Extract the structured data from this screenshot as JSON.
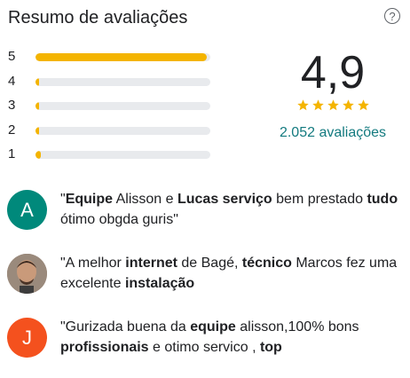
{
  "header": {
    "title": "Resumo de avaliações",
    "help_icon": "?"
  },
  "rating_bars": [
    {
      "label": "5",
      "fraction": 0.98
    },
    {
      "label": "4",
      "fraction": 0.02
    },
    {
      "label": "3",
      "fraction": 0.02
    },
    {
      "label": "2",
      "fraction": 0.02
    },
    {
      "label": "1",
      "fraction": 0.03
    }
  ],
  "summary": {
    "score": "4,9",
    "stars": 5,
    "reviews_count": "2.052 avaliações"
  },
  "colors": {
    "star": "#f4b400",
    "bar_track": "#e8eaed",
    "link": "#137a7f"
  },
  "reviews": [
    {
      "avatar_letter": "A",
      "avatar_type": "letter",
      "parts": [
        {
          "t": "\"",
          "b": false
        },
        {
          "t": "Equipe",
          "b": true
        },
        {
          "t": " Alisson e ",
          "b": false
        },
        {
          "t": "Lucas serviço",
          "b": true
        },
        {
          "t": " bem prestado ",
          "b": false
        },
        {
          "t": "tudo",
          "b": true
        },
        {
          "t": " ótimo obgda guris\"",
          "b": false
        }
      ]
    },
    {
      "avatar_letter": "",
      "avatar_type": "photo",
      "parts": [
        {
          "t": "\"A melhor ",
          "b": false
        },
        {
          "t": "internet",
          "b": true
        },
        {
          "t": " de Bagé, ",
          "b": false
        },
        {
          "t": "técnico",
          "b": true
        },
        {
          "t": " Marcos fez uma excelente ",
          "b": false
        },
        {
          "t": "instalação",
          "b": true
        }
      ]
    },
    {
      "avatar_letter": "J",
      "avatar_type": "letter",
      "parts": [
        {
          "t": "\"Gurizada buena da ",
          "b": false
        },
        {
          "t": "equipe",
          "b": true
        },
        {
          "t": " alisson,100% bons ",
          "b": false
        },
        {
          "t": "profissionais",
          "b": true
        },
        {
          "t": " e otimo servico , ",
          "b": false
        },
        {
          "t": "top",
          "b": true
        }
      ]
    }
  ]
}
